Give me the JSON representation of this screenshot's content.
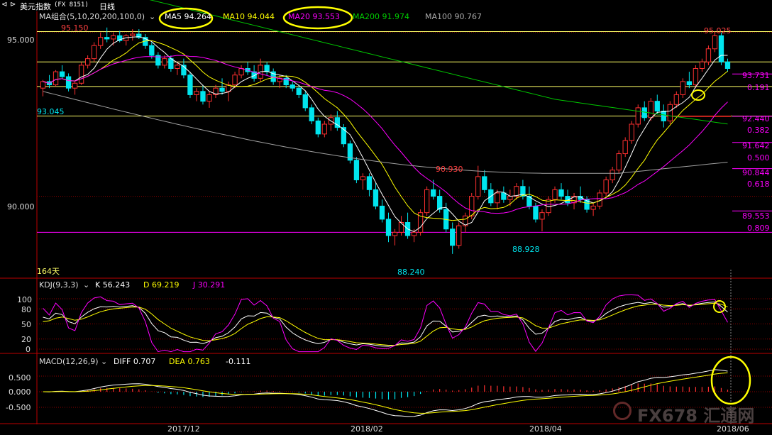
{
  "window": {
    "title": "美元指数",
    "code": "(FX 8151)",
    "period": "日线"
  },
  "colors": {
    "up": "#ff3030",
    "down": "#00e5ee",
    "ma5": "#ffffff",
    "ma10": "#ffff00",
    "ma20": "#ff00ff",
    "ma200": "#00c800",
    "ma100": "#a0a0a0",
    "fib": "#ff00ff",
    "hline": "#ffff66",
    "grid": "#8b0000",
    "annot": "#ffff00"
  },
  "panels": {
    "price": {
      "header": "MA组合(5,10,20,200,100,0)",
      "ma5": "MA5 94.264",
      "ma10": "MA10 94.044",
      "ma20": "MA20 93.553",
      "ma200": "MA200 91.974",
      "ma100": "MA100 90.767",
      "days": "164天"
    },
    "kdj": {
      "header": "KDJ(9,3,3)",
      "k": "K 56.243",
      "d": "D 69.219",
      "j": "J 30.291"
    },
    "macd": {
      "header": "MACD(12,26,9)",
      "diff": "DIFF 0.707",
      "dea": "DEA 0.763",
      "macd": "-0.111"
    }
  },
  "axis": {
    "price_ticks": [
      "95.000",
      "90.000"
    ],
    "kdj_ticks": [
      "100",
      "80",
      "50",
      "20",
      "0"
    ],
    "macd_ticks": [
      "0.500",
      "0.000",
      "-0.500"
    ],
    "dates": [
      "2017/12",
      "2018/02",
      "2018/04",
      "2018/06"
    ]
  },
  "annotations": {
    "high_left": "95.150",
    "low_left": "93.045",
    "high_mid": "90.930",
    "low_mid1": "88.240",
    "low_mid2": "88.928",
    "high_right": "95.025"
  },
  "fib_levels": [
    {
      "price": "93.731",
      "ratio": "0.191"
    },
    {
      "price": "92.440",
      "ratio": "0.382"
    },
    {
      "price": "91.642",
      "ratio": "0.500"
    },
    {
      "price": "90.844",
      "ratio": "0.618"
    },
    {
      "price": "89.553",
      "ratio": "0.809"
    }
  ],
  "watermark": "FX678 汇通网",
  "chart_data": {
    "type": "candlestick",
    "ylim": [
      87.5,
      95.6
    ],
    "candles": [
      [
        93.3,
        93.55,
        93.05,
        93.5
      ],
      [
        93.5,
        93.7,
        93.3,
        93.4
      ],
      [
        93.4,
        93.85,
        93.35,
        93.8
      ],
      [
        93.8,
        94.0,
        93.6,
        93.65
      ],
      [
        93.65,
        93.75,
        93.2,
        93.3
      ],
      [
        93.3,
        93.5,
        93.1,
        93.45
      ],
      [
        93.45,
        94.1,
        93.4,
        94.0
      ],
      [
        94.0,
        94.3,
        93.9,
        94.2
      ],
      [
        94.2,
        94.7,
        94.1,
        94.6
      ],
      [
        94.6,
        95.0,
        94.5,
        94.85
      ],
      [
        94.85,
        95.15,
        94.7,
        94.8
      ],
      [
        94.8,
        95.0,
        94.6,
        94.9
      ],
      [
        94.9,
        95.05,
        94.7,
        94.75
      ],
      [
        94.75,
        94.95,
        94.6,
        94.9
      ],
      [
        94.9,
        95.1,
        94.75,
        94.95
      ],
      [
        94.95,
        95.1,
        94.8,
        94.85
      ],
      [
        94.85,
        94.95,
        94.5,
        94.6
      ],
      [
        94.6,
        94.7,
        94.2,
        94.3
      ],
      [
        94.3,
        94.4,
        93.9,
        94.0
      ],
      [
        94.0,
        94.3,
        93.9,
        94.2
      ],
      [
        94.2,
        94.3,
        93.8,
        93.9
      ],
      [
        93.9,
        94.1,
        93.7,
        94.0
      ],
      [
        94.0,
        94.2,
        93.6,
        93.7
      ],
      [
        93.7,
        93.8,
        93.0,
        93.1
      ],
      [
        93.1,
        93.3,
        92.9,
        93.2
      ],
      [
        93.2,
        93.4,
        92.8,
        92.9
      ],
      [
        92.9,
        93.2,
        92.7,
        93.1
      ],
      [
        93.1,
        93.4,
        93.0,
        93.3
      ],
      [
        93.3,
        93.6,
        93.1,
        93.2
      ],
      [
        93.2,
        93.5,
        92.9,
        93.4
      ],
      [
        93.4,
        93.8,
        93.3,
        93.7
      ],
      [
        93.7,
        94.0,
        93.6,
        93.9
      ],
      [
        93.9,
        94.1,
        93.7,
        93.8
      ],
      [
        93.8,
        94.0,
        93.5,
        93.6
      ],
      [
        93.6,
        94.2,
        93.5,
        94.0
      ],
      [
        94.0,
        94.1,
        93.7,
        93.8
      ],
      [
        93.8,
        93.9,
        93.4,
        93.5
      ],
      [
        93.5,
        93.7,
        93.3,
        93.6
      ],
      [
        93.6,
        93.7,
        93.3,
        93.4
      ],
      [
        93.4,
        93.5,
        93.2,
        93.3
      ],
      [
        93.3,
        93.4,
        93.0,
        93.1
      ],
      [
        93.1,
        93.2,
        92.6,
        92.7
      ],
      [
        92.7,
        92.8,
        92.2,
        92.3
      ],
      [
        92.3,
        92.4,
        91.8,
        91.9
      ],
      [
        91.9,
        92.3,
        91.8,
        92.2
      ],
      [
        92.2,
        92.5,
        92.0,
        92.4
      ],
      [
        92.4,
        92.6,
        92.0,
        92.1
      ],
      [
        92.1,
        92.2,
        91.5,
        91.6
      ],
      [
        91.6,
        91.7,
        91.0,
        91.1
      ],
      [
        91.1,
        91.2,
        90.4,
        90.5
      ],
      [
        90.5,
        90.7,
        90.2,
        90.6
      ],
      [
        90.6,
        90.7,
        90.0,
        90.2
      ],
      [
        90.2,
        90.4,
        89.6,
        89.7
      ],
      [
        89.7,
        89.9,
        89.2,
        89.3
      ],
      [
        89.3,
        89.5,
        88.6,
        88.8
      ],
      [
        88.8,
        89.0,
        88.5,
        88.9
      ],
      [
        88.9,
        89.4,
        88.8,
        89.2
      ],
      [
        89.2,
        89.5,
        88.7,
        88.8
      ],
      [
        88.8,
        89.0,
        88.6,
        88.9
      ],
      [
        88.9,
        89.6,
        88.8,
        89.5
      ],
      [
        89.5,
        90.3,
        89.4,
        90.2
      ],
      [
        90.2,
        90.5,
        89.9,
        90.0
      ],
      [
        90.0,
        90.2,
        89.5,
        89.6
      ],
      [
        89.6,
        89.8,
        88.9,
        89.0
      ],
      [
        89.0,
        89.2,
        88.24,
        88.5
      ],
      [
        88.5,
        89.2,
        88.4,
        89.1
      ],
      [
        89.1,
        89.5,
        88.9,
        89.4
      ],
      [
        89.4,
        90.1,
        89.3,
        90.0
      ],
      [
        90.0,
        90.93,
        89.9,
        90.6
      ],
      [
        90.6,
        90.8,
        90.1,
        90.2
      ],
      [
        90.2,
        90.4,
        89.7,
        89.8
      ],
      [
        89.8,
        90.2,
        89.6,
        90.1
      ],
      [
        90.1,
        90.3,
        89.8,
        89.9
      ],
      [
        89.9,
        90.2,
        89.7,
        90.0
      ],
      [
        90.0,
        90.4,
        89.9,
        90.3
      ],
      [
        90.3,
        90.5,
        89.9,
        90.0
      ],
      [
        90.0,
        90.3,
        89.6,
        89.7
      ],
      [
        89.7,
        89.8,
        89.2,
        89.3
      ],
      [
        89.3,
        89.6,
        88.93,
        89.5
      ],
      [
        89.5,
        90.0,
        89.4,
        89.9
      ],
      [
        89.9,
        90.3,
        89.8,
        90.2
      ],
      [
        90.2,
        90.4,
        89.9,
        90.0
      ],
      [
        90.0,
        90.2,
        89.7,
        89.8
      ],
      [
        89.8,
        90.1,
        89.6,
        90.0
      ],
      [
        90.0,
        90.3,
        89.8,
        89.9
      ],
      [
        89.9,
        90.0,
        89.5,
        89.6
      ],
      [
        89.6,
        89.8,
        89.4,
        89.7
      ],
      [
        89.7,
        90.2,
        89.6,
        90.1
      ],
      [
        90.1,
        90.6,
        90.0,
        90.5
      ],
      [
        90.5,
        90.9,
        90.4,
        90.8
      ],
      [
        90.8,
        91.4,
        90.7,
        91.3
      ],
      [
        91.3,
        91.8,
        91.2,
        91.7
      ],
      [
        91.7,
        92.3,
        91.6,
        92.2
      ],
      [
        92.2,
        92.8,
        92.1,
        92.7
      ],
      [
        92.7,
        92.9,
        92.3,
        92.4
      ],
      [
        92.4,
        93.0,
        92.3,
        92.9
      ],
      [
        92.9,
        93.1,
        92.5,
        92.6
      ],
      [
        92.6,
        92.8,
        92.1,
        92.3
      ],
      [
        92.3,
        92.9,
        92.2,
        92.8
      ],
      [
        92.8,
        93.2,
        92.7,
        93.1
      ],
      [
        93.1,
        93.6,
        93.0,
        93.5
      ],
      [
        93.5,
        93.8,
        93.3,
        93.4
      ],
      [
        93.4,
        94.0,
        93.3,
        93.9
      ],
      [
        93.9,
        94.2,
        93.8,
        94.1
      ],
      [
        94.1,
        94.6,
        94.0,
        94.5
      ],
      [
        94.5,
        95.03,
        94.4,
        94.9
      ],
      [
        94.9,
        95.0,
        94.0,
        94.1
      ],
      [
        94.1,
        94.2,
        93.8,
        93.9
      ]
    ],
    "ma_last": {
      "MA5": 94.264,
      "MA10": 94.044,
      "MA20": 93.553,
      "MA200": 91.974,
      "MA100": 90.767
    },
    "kdj_last": {
      "K": 56.243,
      "D": 69.219,
      "J": 30.291
    },
    "macd_last": {
      "DIFF": 0.707,
      "DEA": 0.763,
      "MACD": -0.111
    },
    "horizontal_lines": [
      95.025,
      94.1,
      93.35,
      92.45,
      88.9
    ],
    "fibonacci": [
      [
        93.731,
        0.191
      ],
      [
        92.44,
        0.382
      ],
      [
        91.642,
        0.5
      ],
      [
        90.844,
        0.618
      ],
      [
        89.553,
        0.809
      ]
    ]
  }
}
